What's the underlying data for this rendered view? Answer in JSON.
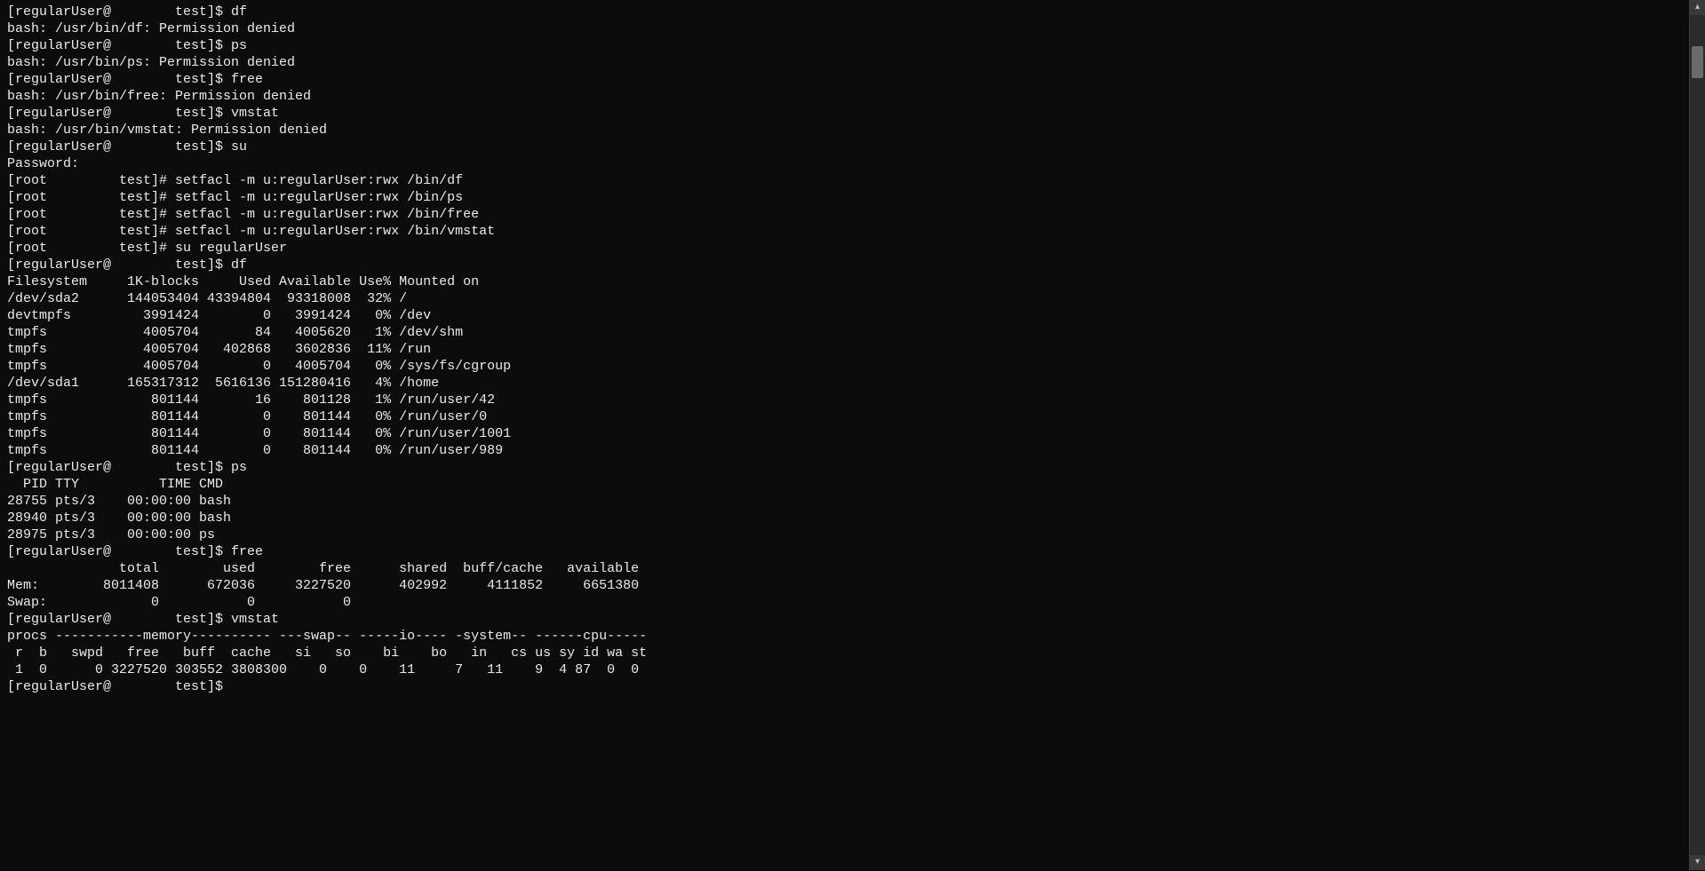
{
  "lines": [
    "[regularUser@        test]$ df",
    "bash: /usr/bin/df: Permission denied",
    "[regularUser@        test]$ ps",
    "bash: /usr/bin/ps: Permission denied",
    "[regularUser@        test]$ free",
    "bash: /usr/bin/free: Permission denied",
    "[regularUser@        test]$ vmstat",
    "bash: /usr/bin/vmstat: Permission denied",
    "[regularUser@        test]$ su",
    "Password:",
    "[root         test]# setfacl -m u:regularUser:rwx /bin/df",
    "[root         test]# setfacl -m u:regularUser:rwx /bin/ps",
    "[root         test]# setfacl -m u:regularUser:rwx /bin/free",
    "[root         test]# setfacl -m u:regularUser:rwx /bin/vmstat",
    "[root         test]# su regularUser",
    "[regularUser@        test]$ df",
    "Filesystem     1K-blocks     Used Available Use% Mounted on",
    "/dev/sda2      144053404 43394804  93318008  32% /",
    "devtmpfs         3991424        0   3991424   0% /dev",
    "tmpfs            4005704       84   4005620   1% /dev/shm",
    "tmpfs            4005704   402868   3602836  11% /run",
    "tmpfs            4005704        0   4005704   0% /sys/fs/cgroup",
    "/dev/sda1      165317312  5616136 151280416   4% /home",
    "tmpfs             801144       16    801128   1% /run/user/42",
    "tmpfs             801144        0    801144   0% /run/user/0",
    "tmpfs             801144        0    801144   0% /run/user/1001",
    "tmpfs             801144        0    801144   0% /run/user/989",
    "[regularUser@        test]$ ps",
    "  PID TTY          TIME CMD",
    "28755 pts/3    00:00:00 bash",
    "28940 pts/3    00:00:00 bash",
    "28975 pts/3    00:00:00 ps",
    "[regularUser@        test]$ free",
    "              total        used        free      shared  buff/cache   available",
    "Mem:        8011408      672036     3227520      402992     4111852     6651380",
    "Swap:             0           0           0",
    "[regularUser@        test]$ vmstat",
    "procs -----------memory---------- ---swap-- -----io---- -system-- ------cpu-----",
    " r  b   swpd   free   buff  cache   si   so    bi    bo   in   cs us sy id wa st",
    " 1  0      0 3227520 303552 3808300    0    0    11     7   11    9  4 87  0  0",
    "[regularUser@        test]$"
  ],
  "scroll": {
    "up_glyph": "▴",
    "down_glyph": "▾"
  }
}
